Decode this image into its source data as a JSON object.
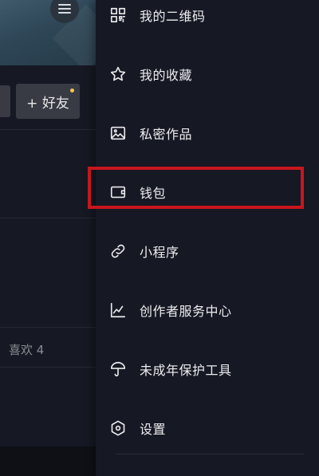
{
  "background_page": {
    "add_friend_label": "+ 好友",
    "likes_tab_label": "喜欢 4"
  },
  "drawer": {
    "items": [
      {
        "label": "我的二维码",
        "icon": "qr-code-icon"
      },
      {
        "label": "我的收藏",
        "icon": "star-icon"
      },
      {
        "label": "私密作品",
        "icon": "private-image-icon"
      },
      {
        "label": "钱包",
        "icon": "wallet-icon",
        "highlighted": true
      },
      {
        "label": "小程序",
        "icon": "link-icon"
      },
      {
        "label": "创作者服务中心",
        "icon": "trend-chart-icon"
      },
      {
        "label": "未成年保护工具",
        "icon": "umbrella-icon"
      },
      {
        "label": "设置",
        "icon": "hexagon-settings-icon"
      }
    ]
  },
  "colors": {
    "background": "#161823",
    "highlight_border": "#c8161d",
    "text_primary": "#ededf0",
    "text_muted": "#8a8b91",
    "notification_dot": "#f2c94c"
  }
}
